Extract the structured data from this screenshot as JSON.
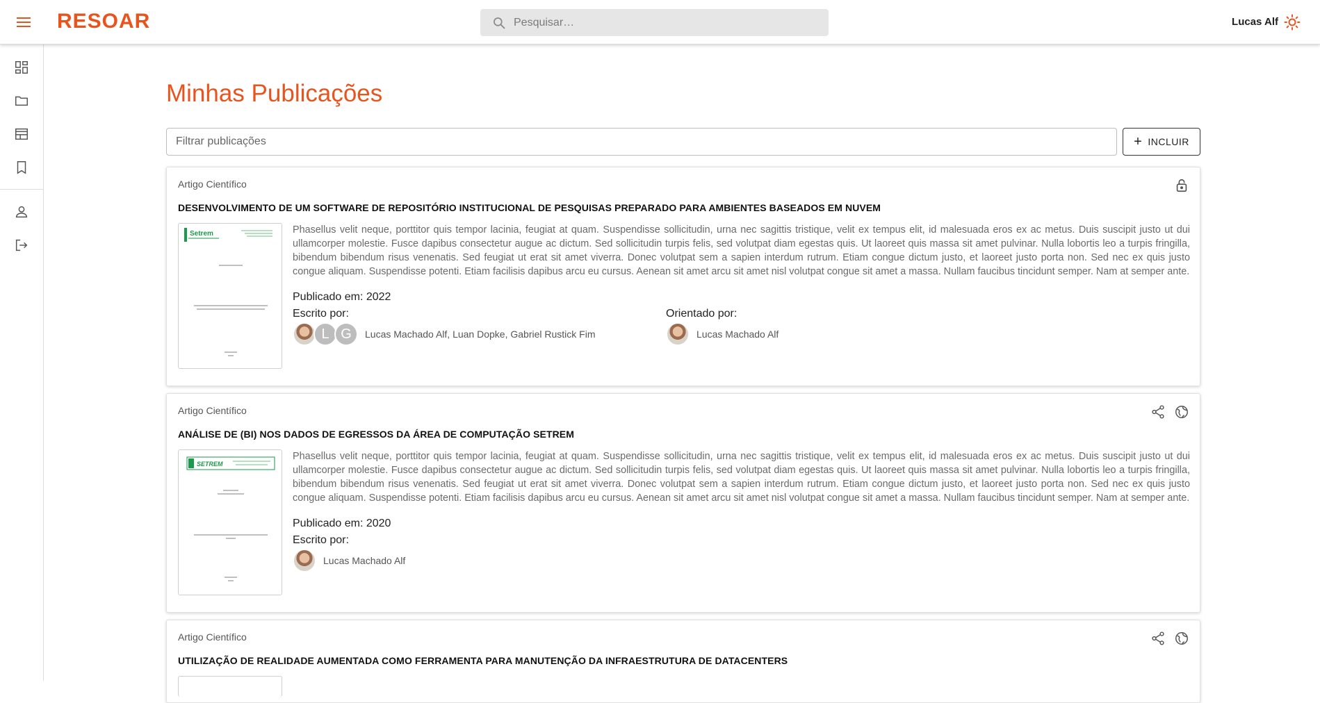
{
  "header": {
    "brand": "RESOAR",
    "search_placeholder": "Pesquisar…",
    "user_name": "Lucas Alf"
  },
  "sidebar": {
    "items": [
      {
        "name": "dashboard-icon"
      },
      {
        "name": "folder-icon"
      },
      {
        "name": "table-icon"
      },
      {
        "name": "bookmark-icon"
      },
      {
        "name": "person-icon"
      },
      {
        "name": "logout-icon"
      }
    ]
  },
  "main": {
    "title": "Minhas Publicações",
    "filter_placeholder": "Filtrar publicações",
    "add_label": "INCLUIR"
  },
  "publications": [
    {
      "type": "Artigo Científico",
      "title": "DESENVOLVIMENTO DE UM SOFTWARE DE REPOSITÓRIO INSTITUCIONAL DE PESQUISAS PREPARADO PARA AMBIENTES BASEADOS EM NUVEM",
      "abstract": "Phasellus velit neque, porttitor quis tempor lacinia, feugiat at quam. Suspendisse sollicitudin, urna nec sagittis tristique, velit ex tempus elit, id malesuada eros ex ac metus. Duis suscipit justo ut dui ullamcorper molestie. Fusce dapibus consectetur augue ac dictum. Sed sollicitudin turpis felis, sed volutpat diam egestas quis. Ut laoreet quis massa sit amet pulvinar. Nulla lobortis leo a turpis fringilla, bibendum bibendum risus venenatis. Sed feugiat ut erat sit amet viverra. Donec volutpat sem a sapien interdum rutrum. Etiam congue dictum justo, et laoreet justo porta non. Sed nec ex quis justo congue aliquam. Suspendisse potenti. Etiam facilisis dapibus arcu eu cursus. Aenean sit amet arcu sit amet nisl volutpat congue sit amet a massa. Nullam faucibus tincidunt semper. Nam at semper ante.",
      "published": "Publicado em: 2022",
      "written_label": "Escrito por:",
      "authors": "Lucas Machado Alf, Luan Dopke, Gabriel Rustick Fim",
      "author_initials": [
        "L",
        "G"
      ],
      "advised_label": "Orientado por:",
      "advisor": "Lucas Machado Alf",
      "icons": [
        "lock-open-icon"
      ]
    },
    {
      "type": "Artigo Científico",
      "title": "ANÁLISE DE (BI) NOS DADOS DE EGRESSOS DA ÁREA DE COMPUTAÇÃO SETREM",
      "abstract": "Phasellus velit neque, porttitor quis tempor lacinia, feugiat at quam. Suspendisse sollicitudin, urna nec sagittis tristique, velit ex tempus elit, id malesuada eros ex ac metus. Duis suscipit justo ut dui ullamcorper molestie. Fusce dapibus consectetur augue ac dictum. Sed sollicitudin turpis felis, sed volutpat diam egestas quis. Ut laoreet quis massa sit amet pulvinar. Nulla lobortis leo a turpis fringilla, bibendum bibendum risus venenatis. Sed feugiat ut erat sit amet viverra. Donec volutpat sem a sapien interdum rutrum. Etiam congue dictum justo, et laoreet justo porta non. Sed nec ex quis justo congue aliquam. Suspendisse potenti. Etiam facilisis dapibus arcu eu cursus. Aenean sit amet arcu sit amet nisl volutpat congue sit amet a massa. Nullam faucibus tincidunt semper. Nam at semper ante.",
      "published": "Publicado em: 2020",
      "written_label": "Escrito por:",
      "authors": "Lucas Machado Alf",
      "icons": [
        "share-icon",
        "globe-icon"
      ]
    },
    {
      "type": "Artigo Científico",
      "title": "UTILIZAÇÃO DE REALIDADE AUMENTADA COMO FERRAMENTA PARA MANUTENÇÃO DA INFRAESTRUTURA DE DATACENTERS",
      "icons": [
        "share-icon",
        "globe-icon"
      ]
    }
  ],
  "colors": {
    "accent": "#e8541e",
    "setrem_green": "#1a9a4a"
  }
}
